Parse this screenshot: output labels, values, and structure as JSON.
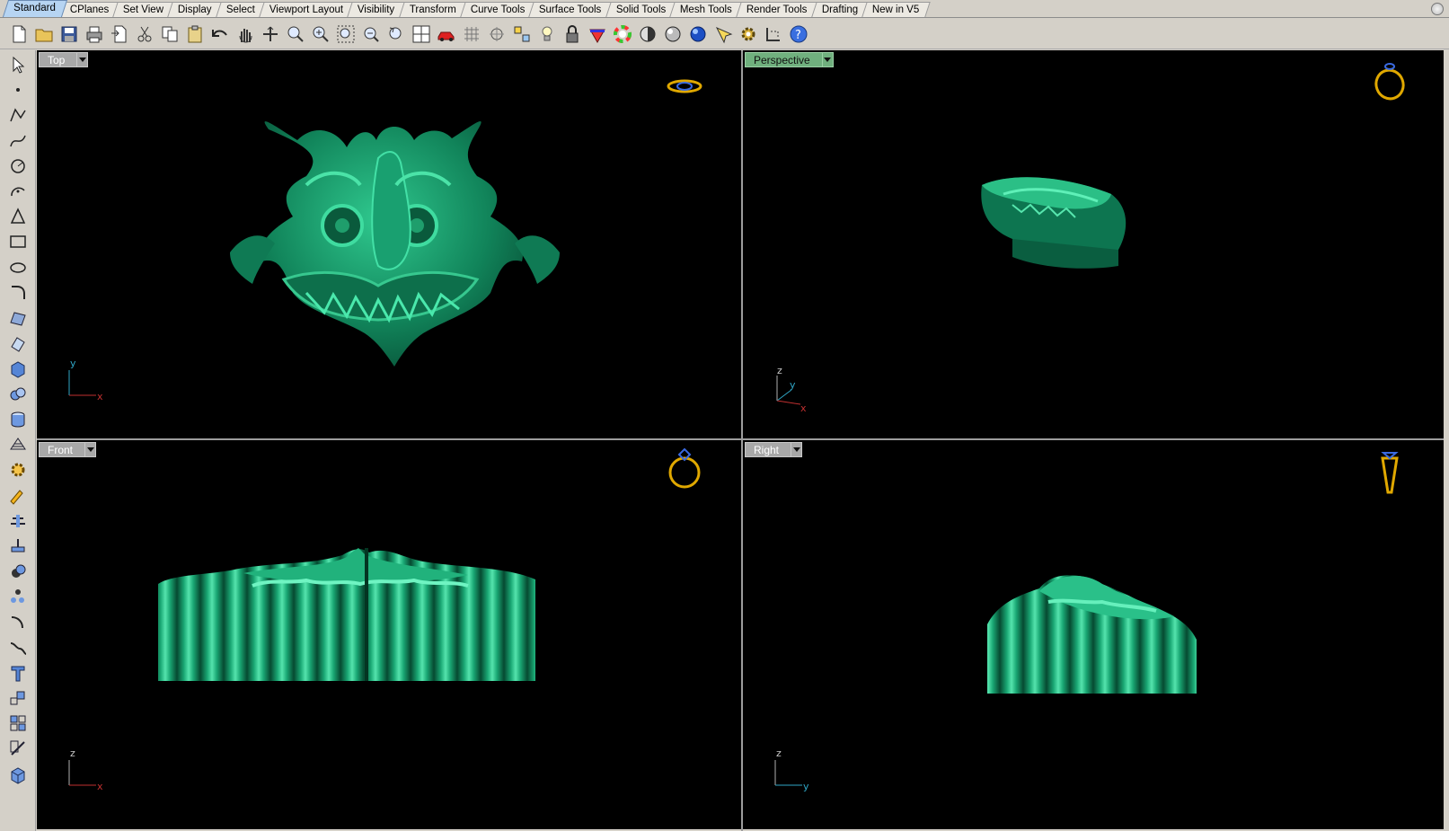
{
  "tabs": [
    "Standard",
    "CPlanes",
    "Set View",
    "Display",
    "Select",
    "Viewport Layout",
    "Visibility",
    "Transform",
    "Curve Tools",
    "Surface Tools",
    "Solid Tools",
    "Mesh Tools",
    "Render Tools",
    "Drafting",
    "New in V5"
  ],
  "active_tab": "Standard",
  "toolbar_icons": [
    "new-file-icon",
    "open-folder-icon",
    "save-icon",
    "print-icon",
    "import-icon",
    "cut-icon",
    "copy-icon",
    "paste-icon",
    "undo-icon",
    "pan-hand-icon",
    "rotate-view-icon",
    "zoom-window-icon",
    "zoom-dynamic-icon",
    "zoom-extents-icon",
    "zoom-selected-icon",
    "rotate-camera-icon",
    "four-viewports-icon",
    "car-icon",
    "grid-icon",
    "cplane-icon",
    "object-snap-icon",
    "light-bulb-icon",
    "lock-icon",
    "layer-icon",
    "color-wheel-icon",
    "shaded-sphere-icon",
    "rendered-sphere-icon",
    "blue-sphere-icon",
    "select-filter-icon",
    "options-gear-icon",
    "dimension-icon",
    "help-icon"
  ],
  "left_tools": [
    "select-arrow-icon",
    "point-icon",
    "polyline-icon",
    "curve-icon",
    "circle-icon",
    "arc-icon",
    "polygon-icon",
    "rectangle-icon",
    "ellipse-icon",
    "fillet-curve-icon",
    "surface-icon",
    "extrude-surface-icon",
    "box-solid-icon",
    "boolean-union-icon",
    "cylinder-icon",
    "mesh-icon",
    "gear-transform-icon",
    "analyze-icon",
    "dimension-tool-icon",
    "move-icon",
    "boolean-icon",
    "array-icon",
    "offset-icon",
    "blend-icon",
    "text-icon",
    "scale-icon",
    "group-icon",
    "split-icon",
    "render-box-icon"
  ],
  "more_label": "»",
  "viewports": {
    "top": {
      "label": "Top",
      "axis1": "y",
      "axis2": "x"
    },
    "perspective": {
      "label": "Perspective",
      "axis1": "z",
      "axis2": "y",
      "axis3": "x"
    },
    "front": {
      "label": "Front",
      "axis1": "z",
      "axis2": "x"
    },
    "right": {
      "label": "Right",
      "axis1": "z",
      "axis2": "y"
    }
  },
  "active_viewport": "perspective",
  "colors": {
    "model": "#138a60",
    "model_hi": "#3fd79c",
    "ring": "#d9a400",
    "axis_x": "#c03030",
    "axis_y": "#2fa6c6",
    "axis_z": "#b0b0b0"
  }
}
